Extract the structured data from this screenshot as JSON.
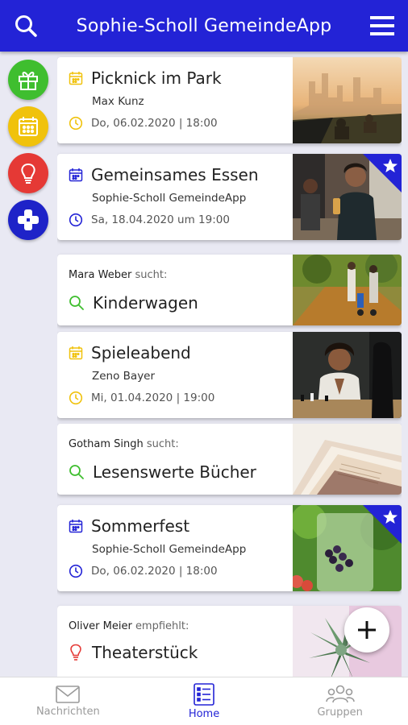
{
  "header": {
    "title": "Sophie-Scholl GemeindeApp",
    "search_icon": "search-icon",
    "menu_icon": "hamburger-menu-icon"
  },
  "rail": [
    {
      "icon": "gift-icon",
      "color": "#3fbe2f"
    },
    {
      "icon": "calendar-icon",
      "color": "#f0c20c"
    },
    {
      "icon": "lightbulb-icon",
      "color": "#e53935"
    },
    {
      "icon": "plus-cross-icon",
      "color": "#1e23c8"
    }
  ],
  "cards": [
    {
      "kind": "event",
      "title": "Picknick im Park",
      "organizer": "Max Kunz",
      "date": "Do, 06.02.2020 | 18:00",
      "accent": "#f0c20c",
      "starred": false
    },
    {
      "kind": "event",
      "title": "Gemeinsames Essen",
      "organizer": "Sophie-Scholl GemeindeApp",
      "date": "Sa, 18.04.2020 um 19:00",
      "accent": "#2323d6",
      "starred": true
    },
    {
      "kind": "search",
      "person": "Mara Weber",
      "verb": "sucht:",
      "title": "Kinderwagen"
    },
    {
      "kind": "event",
      "title": "Spieleabend",
      "organizer": "Zeno Bayer",
      "date": "Mi, 01.04.2020 | 19:00",
      "accent": "#f0c20c",
      "starred": false
    },
    {
      "kind": "search",
      "person": "Gotham Singh",
      "verb": "sucht:",
      "title": "Lesenswerte Bücher"
    },
    {
      "kind": "event",
      "title": "Sommerfest",
      "organizer": "Sophie-Scholl GemeindeApp",
      "date": "Do, 06.02.2020 | 18:00",
      "accent": "#2323d6",
      "starred": true
    },
    {
      "kind": "recommend",
      "person": "Oliver Meier",
      "verb": "empfiehlt:",
      "title": "Theaterstück"
    }
  ],
  "fab": {
    "icon": "plus-icon"
  },
  "nav": [
    {
      "label": "Nachrichten",
      "icon": "envelope-icon",
      "active": false
    },
    {
      "label": "Home",
      "icon": "list-icon",
      "active": true
    },
    {
      "label": "Gruppen",
      "icon": "group-icon",
      "active": false
    }
  ],
  "colors": {
    "primary": "#2323d6",
    "event_yellow": "#f0c20c",
    "search_green": "#3fbe2f",
    "recommend_red": "#e53935"
  }
}
